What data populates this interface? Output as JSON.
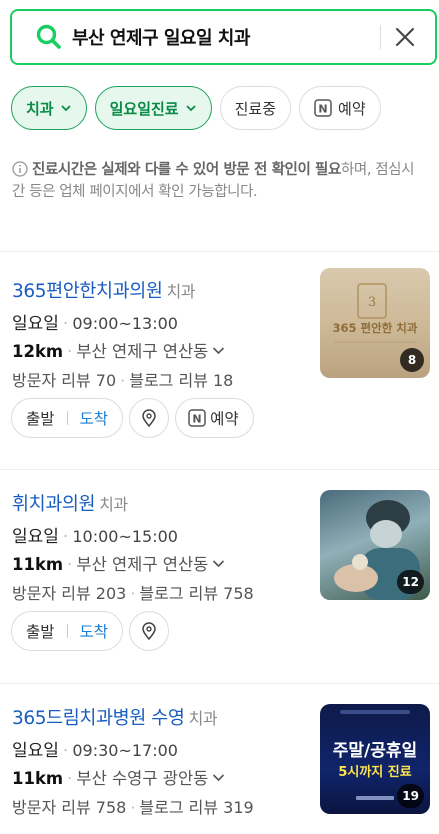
{
  "search": {
    "query": "부산 연제구 일요일 치과"
  },
  "filters": [
    {
      "label": "치과",
      "active": true,
      "dropdown": true
    },
    {
      "label": "일요일진료",
      "active": true,
      "dropdown": true
    },
    {
      "label": "진료중",
      "active": false,
      "dropdown": false
    },
    {
      "label": "예약",
      "active": false,
      "dropdown": false,
      "badge": "N"
    }
  ],
  "notice": {
    "bold1": "진료시간은 실제와 다를 수 있어 방문 전 확인이 필요",
    "rest": "하며, 점심시간 등은 업체 페이지에서 확인 가능합니다."
  },
  "results": [
    {
      "name": "365편안한치과의원",
      "category": "치과",
      "day": "일요일",
      "hours": "09:00~13:00",
      "distance": "12km",
      "address": "부산 연제구 연산동",
      "visitor_reviews": "방문자 리뷰 70",
      "blog_reviews": "블로그 리뷰 18",
      "photo_count": "8",
      "thumb_text": "365 편안한 치과",
      "depart_label": "출발",
      "arrive_label": "도착",
      "reserve_label": "예약",
      "has_reserve": true
    },
    {
      "name": "휘치과의원",
      "category": "치과",
      "day": "일요일",
      "hours": "10:00~15:00",
      "distance": "11km",
      "address": "부산 연제구 연산동",
      "visitor_reviews": "방문자 리뷰 203",
      "blog_reviews": "블로그 리뷰 758",
      "photo_count": "12",
      "depart_label": "출발",
      "arrive_label": "도착",
      "has_reserve": false
    },
    {
      "name": "365드림치과병원 수영",
      "category": "치과",
      "day": "일요일",
      "hours": "09:30~17:00",
      "distance": "11km",
      "address": "부산 수영구 광안동",
      "visitor_reviews": "방문자 리뷰 758",
      "blog_reviews": "블로그 리뷰 319",
      "photo_count": "19",
      "thumb_line1": "주말/공휴일",
      "thumb_line2": "5시까지 진료"
    }
  ],
  "colors": {
    "accent_green": "#19ce60",
    "link_blue": "#1a5dc2",
    "arrive_blue": "#1a7fd6"
  }
}
